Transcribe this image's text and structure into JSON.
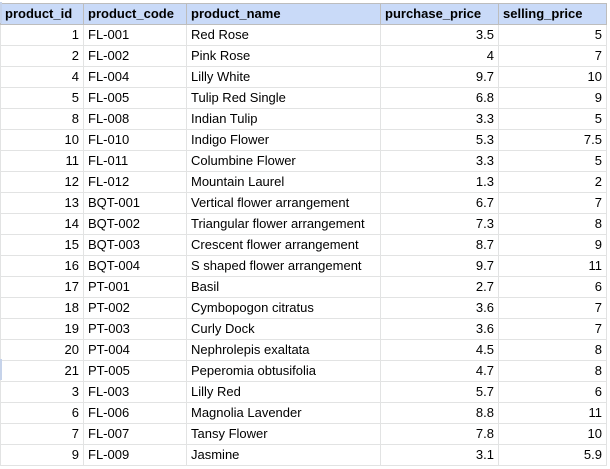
{
  "columns": [
    "product_id",
    "product_code",
    "product_name",
    "purchase_price",
    "selling_price"
  ],
  "rows": [
    [
      "1",
      "FL-001",
      "Red Rose",
      "3.5",
      "5"
    ],
    [
      "2",
      "FL-002",
      "Pink Rose",
      "4",
      "7"
    ],
    [
      "4",
      "FL-004",
      "Lilly White",
      "9.7",
      "10"
    ],
    [
      "5",
      "FL-005",
      "Tulip Red Single",
      "6.8",
      "9"
    ],
    [
      "8",
      "FL-008",
      "Indian Tulip",
      "3.3",
      "5"
    ],
    [
      "10",
      "FL-010",
      "Indigo Flower",
      "5.3",
      "7.5"
    ],
    [
      "11",
      "FL-011",
      "Columbine Flower",
      "3.3",
      "5"
    ],
    [
      "12",
      "FL-012",
      "Mountain Laurel",
      "1.3",
      "2"
    ],
    [
      "13",
      "BQT-001",
      "Vertical flower arrangement",
      "6.7",
      "7"
    ],
    [
      "14",
      "BQT-002",
      "Triangular flower arrangement",
      "7.3",
      "8"
    ],
    [
      "15",
      "BQT-003",
      "Crescent flower arrangement",
      "8.7",
      "9"
    ],
    [
      "16",
      "BQT-004",
      "S shaped flower arrangement",
      "9.7",
      "11"
    ],
    [
      "17",
      "PT-001",
      "Basil",
      "2.7",
      "6"
    ],
    [
      "18",
      "PT-002",
      "Cymbopogon citratus",
      "3.6",
      "7"
    ],
    [
      "19",
      "PT-003",
      "Curly Dock",
      "3.6",
      "7"
    ],
    [
      "20",
      "PT-004",
      "Nephrolepis exaltata",
      "4.5",
      "8"
    ],
    [
      "21",
      "PT-005",
      "Peperomia obtusifolia",
      "4.7",
      "8"
    ],
    [
      "3",
      "FL-003",
      "Lilly Red",
      "5.7",
      "6"
    ],
    [
      "6",
      "FL-006",
      "Magnolia Lavender",
      "8.8",
      "11"
    ],
    [
      "7",
      "FL-007",
      "Tansy Flower",
      "7.8",
      "10"
    ],
    [
      "9",
      "FL-009",
      "Jasmine",
      "3.1",
      "5.9"
    ]
  ],
  "column_align": [
    "right",
    "left",
    "left",
    "right",
    "right"
  ],
  "colors": {
    "header_background": "#c9daf8",
    "grid_line": "#e2e3e3"
  }
}
